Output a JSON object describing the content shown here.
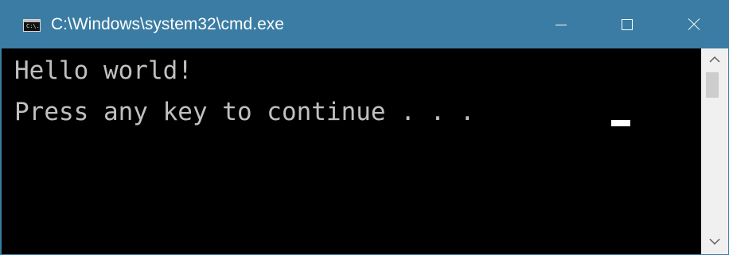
{
  "window": {
    "title": "C:\\Windows\\system32\\cmd.exe",
    "app_icon": "cmd-icon",
    "app_icon_text": "C:\\.",
    "controls": {
      "minimize_icon": "minimize-icon",
      "maximize_icon": "maximize-icon",
      "close_icon": "close-icon"
    }
  },
  "console": {
    "lines": [
      "Hello world!",
      "Press any key to continue . . ."
    ],
    "cursor": "_"
  },
  "scrollbar": {
    "up_icon": "chevron-up-icon",
    "down_icon": "chevron-down-icon"
  },
  "colors": {
    "titlebar": "#3a7ca3",
    "console_background": "#000000",
    "console_text": "#c0c0c0"
  }
}
